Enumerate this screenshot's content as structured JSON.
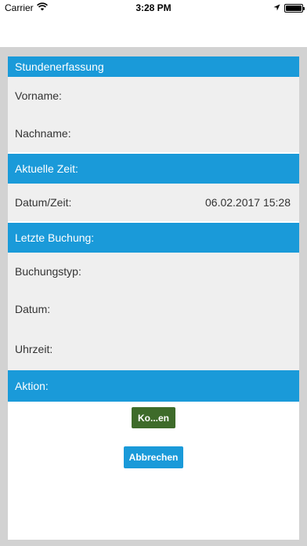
{
  "status_bar": {
    "carrier": "Carrier",
    "time": "3:28 PM",
    "wifi_icon": "wifi-icon",
    "location_icon": "location-arrow-icon",
    "battery_icon": "battery-icon"
  },
  "sections": {
    "stundenerfassung": {
      "title": "Stundenerfassung",
      "vorname_label": "Vorname:",
      "nachname_label": "Nachname:"
    },
    "aktuelle_zeit": {
      "title": "Aktuelle Zeit:",
      "datum_zeit_label": "Datum/Zeit:",
      "datum_zeit_value": "06.02.2017 15:28"
    },
    "letzte_buchung": {
      "title": "Letzte Buchung:",
      "buchungstyp_label": "Buchungstyp:",
      "datum_label": "Datum:",
      "uhrzeit_label": "Uhrzeit:"
    },
    "aktion": {
      "title": "Aktion:",
      "primary_button": "Ko...en",
      "cancel_button": "Abbrechen"
    }
  },
  "colors": {
    "header_blue": "#1a9ad9",
    "button_green": "#3e6b2a",
    "row_gray": "#efefef",
    "frame_gray": "#d2d2d2"
  }
}
